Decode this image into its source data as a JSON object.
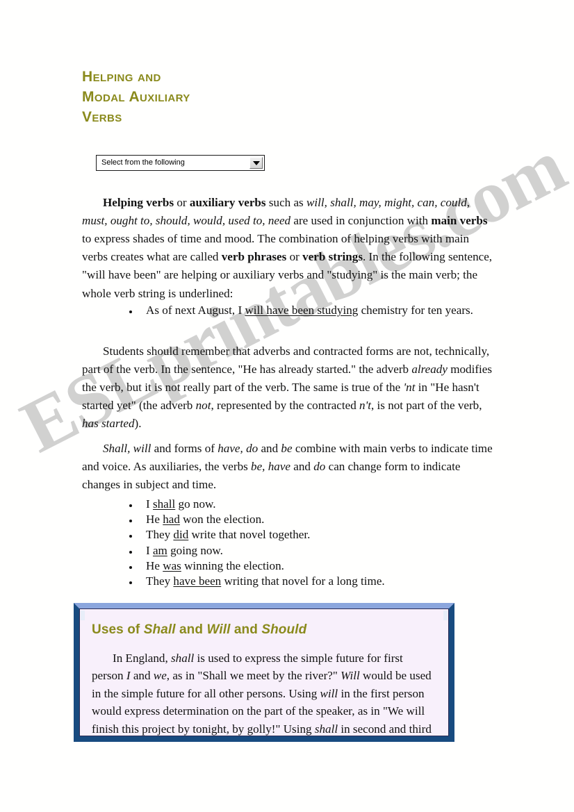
{
  "document": {
    "title_lines": [
      "Helping and",
      "Modal Auxiliary",
      "Verbs"
    ],
    "watermark": "ESLprintables.com",
    "colors": {
      "heading": "#8a8a1c",
      "callout_border_outer": "#184b80",
      "callout_border_top": "#8ba6dd",
      "callout_background": "#f8f0fb",
      "body_text": "#121212"
    }
  },
  "select": {
    "value": "Select from the following",
    "arrow": "chevron-down-icon"
  },
  "paragraphs": {
    "p1": {
      "segments": [
        {
          "text": "Helping verbs",
          "style": "bold"
        },
        {
          "text": " or ",
          "style": "normal"
        },
        {
          "text": "auxiliary verbs",
          "style": "bold"
        },
        {
          "text": " such as ",
          "style": "normal"
        },
        {
          "text": "will, shall, may, might, can, could, must, ought to, should, would, used to, need",
          "style": "italic"
        },
        {
          "text": " are used in conjunction with ",
          "style": "normal"
        },
        {
          "text": "main verbs",
          "style": "bold"
        },
        {
          "text": " to express shades of time and mood. The combination of helping verbs with main verbs creates what are called ",
          "style": "normal"
        },
        {
          "text": "verb phrases",
          "style": "bold"
        },
        {
          "text": " or ",
          "style": "normal"
        },
        {
          "text": "verb strings",
          "style": "bold"
        },
        {
          "text": ". In the following sentence, \"will have been\" are helping or auxiliary verbs and \"studying\" is the main verb; the whole verb string is underlined:",
          "style": "normal"
        }
      ]
    },
    "p2": {
      "segments": [
        {
          "text": "Students should remember that adverbs and contracted forms are not, technically, part of the verb. In the sentence, \"He has already started.\" the adverb ",
          "style": "normal"
        },
        {
          "text": "already",
          "style": "italic"
        },
        {
          "text": " modifies the verb, but it is not really part of the verb. The same is true of the ",
          "style": "normal"
        },
        {
          "text": "'nt",
          "style": "italic"
        },
        {
          "text": " in \"He hasn't started yet\" (the adverb ",
          "style": "normal"
        },
        {
          "text": "not",
          "style": "italic"
        },
        {
          "text": ", represented by the contracted ",
          "style": "normal"
        },
        {
          "text": "n't",
          "style": "italic"
        },
        {
          "text": ", is not part of the verb, ",
          "style": "normal"
        },
        {
          "text": "has started",
          "style": "italic"
        },
        {
          "text": ").",
          "style": "normal"
        }
      ]
    },
    "p3": {
      "segments": [
        {
          "text": "Shall, will",
          "style": "italic"
        },
        {
          "text": " and forms of ",
          "style": "normal"
        },
        {
          "text": "have, do",
          "style": "italic"
        },
        {
          "text": " and ",
          "style": "normal"
        },
        {
          "text": "be",
          "style": "italic"
        },
        {
          "text": " combine with main verbs to indicate time and voice. As auxiliaries, the verbs ",
          "style": "normal"
        },
        {
          "text": "be, have",
          "style": "italic"
        },
        {
          "text": " and ",
          "style": "normal"
        },
        {
          "text": "do",
          "style": "italic"
        },
        {
          "text": " can change form to indicate changes in subject and time.",
          "style": "normal"
        }
      ]
    }
  },
  "bullets_single": [
    {
      "segments": [
        {
          "text": "As of next August, I ",
          "style": "normal"
        },
        {
          "text": "will have been studying",
          "style": "underline"
        },
        {
          "text": " chemistry for ten years.",
          "style": "normal"
        }
      ]
    }
  ],
  "bullets_examples": [
    {
      "segments": [
        {
          "text": "I ",
          "style": "normal"
        },
        {
          "text": "shall",
          "style": "underline"
        },
        {
          "text": " go now.",
          "style": "normal"
        }
      ]
    },
    {
      "segments": [
        {
          "text": "He ",
          "style": "normal"
        },
        {
          "text": "had",
          "style": "underline"
        },
        {
          "text": " won the election.",
          "style": "normal"
        }
      ]
    },
    {
      "segments": [
        {
          "text": "They ",
          "style": "normal"
        },
        {
          "text": "did",
          "style": "underline"
        },
        {
          "text": " write that novel together.",
          "style": "normal"
        }
      ]
    },
    {
      "segments": [
        {
          "text": "I ",
          "style": "normal"
        },
        {
          "text": "am",
          "style": "underline"
        },
        {
          "text": " going now.",
          "style": "normal"
        }
      ]
    },
    {
      "segments": [
        {
          "text": "He ",
          "style": "normal"
        },
        {
          "text": "was",
          "style": "underline"
        },
        {
          "text": " winning the election.",
          "style": "normal"
        }
      ]
    },
    {
      "segments": [
        {
          "text": "They ",
          "style": "normal"
        },
        {
          "text": "have been",
          "style": "underline"
        },
        {
          "text": " writing that novel for a long time.",
          "style": "normal"
        }
      ]
    }
  ],
  "callout": {
    "heading_segments": [
      {
        "text": "Uses of ",
        "style": "normal"
      },
      {
        "text": "Shall",
        "style": "italic"
      },
      {
        "text": " and ",
        "style": "normal"
      },
      {
        "text": "Will",
        "style": "italic"
      },
      {
        "text": " and ",
        "style": "normal"
      },
      {
        "text": "Should",
        "style": "italic"
      }
    ],
    "body_segments": [
      {
        "text": "In England, ",
        "style": "normal"
      },
      {
        "text": "shall",
        "style": "italic"
      },
      {
        "text": " is used to express the simple future for first person ",
        "style": "normal"
      },
      {
        "text": "I",
        "style": "italic"
      },
      {
        "text": " and ",
        "style": "normal"
      },
      {
        "text": "we",
        "style": "italic"
      },
      {
        "text": ", as in \"Shall we meet by the river?\" ",
        "style": "normal"
      },
      {
        "text": "Will",
        "style": "italic"
      },
      {
        "text": " would be used in the simple future for all other persons. Using ",
        "style": "normal"
      },
      {
        "text": "will",
        "style": "italic"
      },
      {
        "text": " in the first person would express determination on the part of the speaker, as in \"We will finish this project by tonight, by golly!\" Using ",
        "style": "normal"
      },
      {
        "text": "shall",
        "style": "italic"
      },
      {
        "text": " in second and third persons would indicate",
        "style": "normal"
      }
    ]
  }
}
